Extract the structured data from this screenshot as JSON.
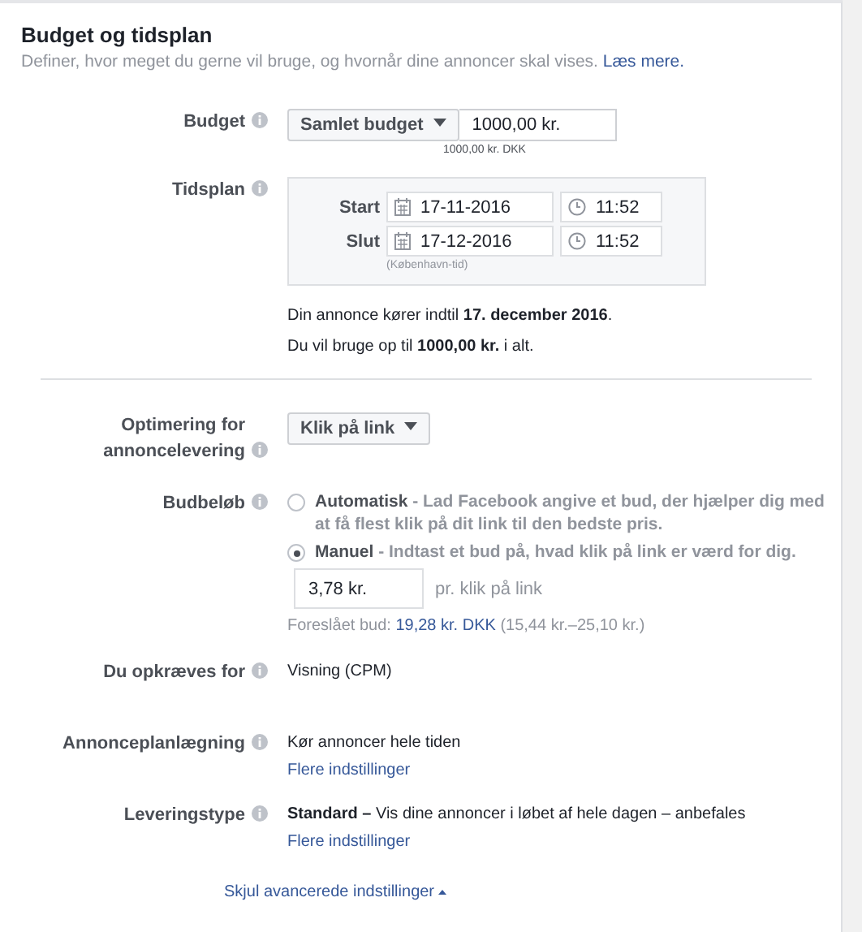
{
  "section": {
    "title": "Budget og tidsplan",
    "description": "Definer, hvor meget du gerne vil bruge, og hvornår dine annoncer skal vises.",
    "learn_more": "Læs mere."
  },
  "budget": {
    "label": "Budget",
    "type_dropdown": "Samlet budget",
    "amount": "1000,00 kr.",
    "amount_hint": "1000,00 kr. DKK"
  },
  "schedule": {
    "label": "Tidsplan",
    "rows": [
      {
        "label": "Start",
        "date": "17-11-2016",
        "time": "11:52"
      },
      {
        "label": "Slut",
        "date": "17-12-2016",
        "time": "11:52"
      }
    ],
    "timezone": "(København-tid)",
    "summary_run": "Din annonce kører indtil **17. december 2016**.",
    "summary_spend": "Du vil bruge op til **1000,00 kr.** i alt."
  },
  "optimization": {
    "label": "Optimering for annoncelevering",
    "dropdown": "Klik på link"
  },
  "bid": {
    "label": "Budbeløb",
    "options": [
      {
        "text": "**Automatisk** - Lad Facebook angive et bud, der hjælper dig med at få flest klik på dit link til den bedste pris.",
        "selected": false
      },
      {
        "text": "**Manuel** - Indtast et bud på, hvad klik på link er værd for dig.",
        "selected": true
      }
    ],
    "amount": "3,78 kr.",
    "amount_suffix": "pr. klik på link",
    "suggested_label": "Foreslået bud:",
    "suggested_value": "19,28 kr. DKK",
    "suggested_range": "(15,44 kr.–25,10 kr.)"
  },
  "charged_for": {
    "label": "Du opkræves for",
    "value": "Visning (CPM)"
  },
  "ad_scheduling": {
    "label": "Annonceplanlægning",
    "value": "Kør annoncer hele tiden",
    "link": "Flere indstillinger"
  },
  "delivery_type": {
    "label": "Leveringstype",
    "value": "**Standard –** Vis dine annoncer i løbet af hele dagen – anbefales",
    "link": "Flere indstillinger"
  },
  "toggle_link": "Skjul avancerede indstillinger"
}
